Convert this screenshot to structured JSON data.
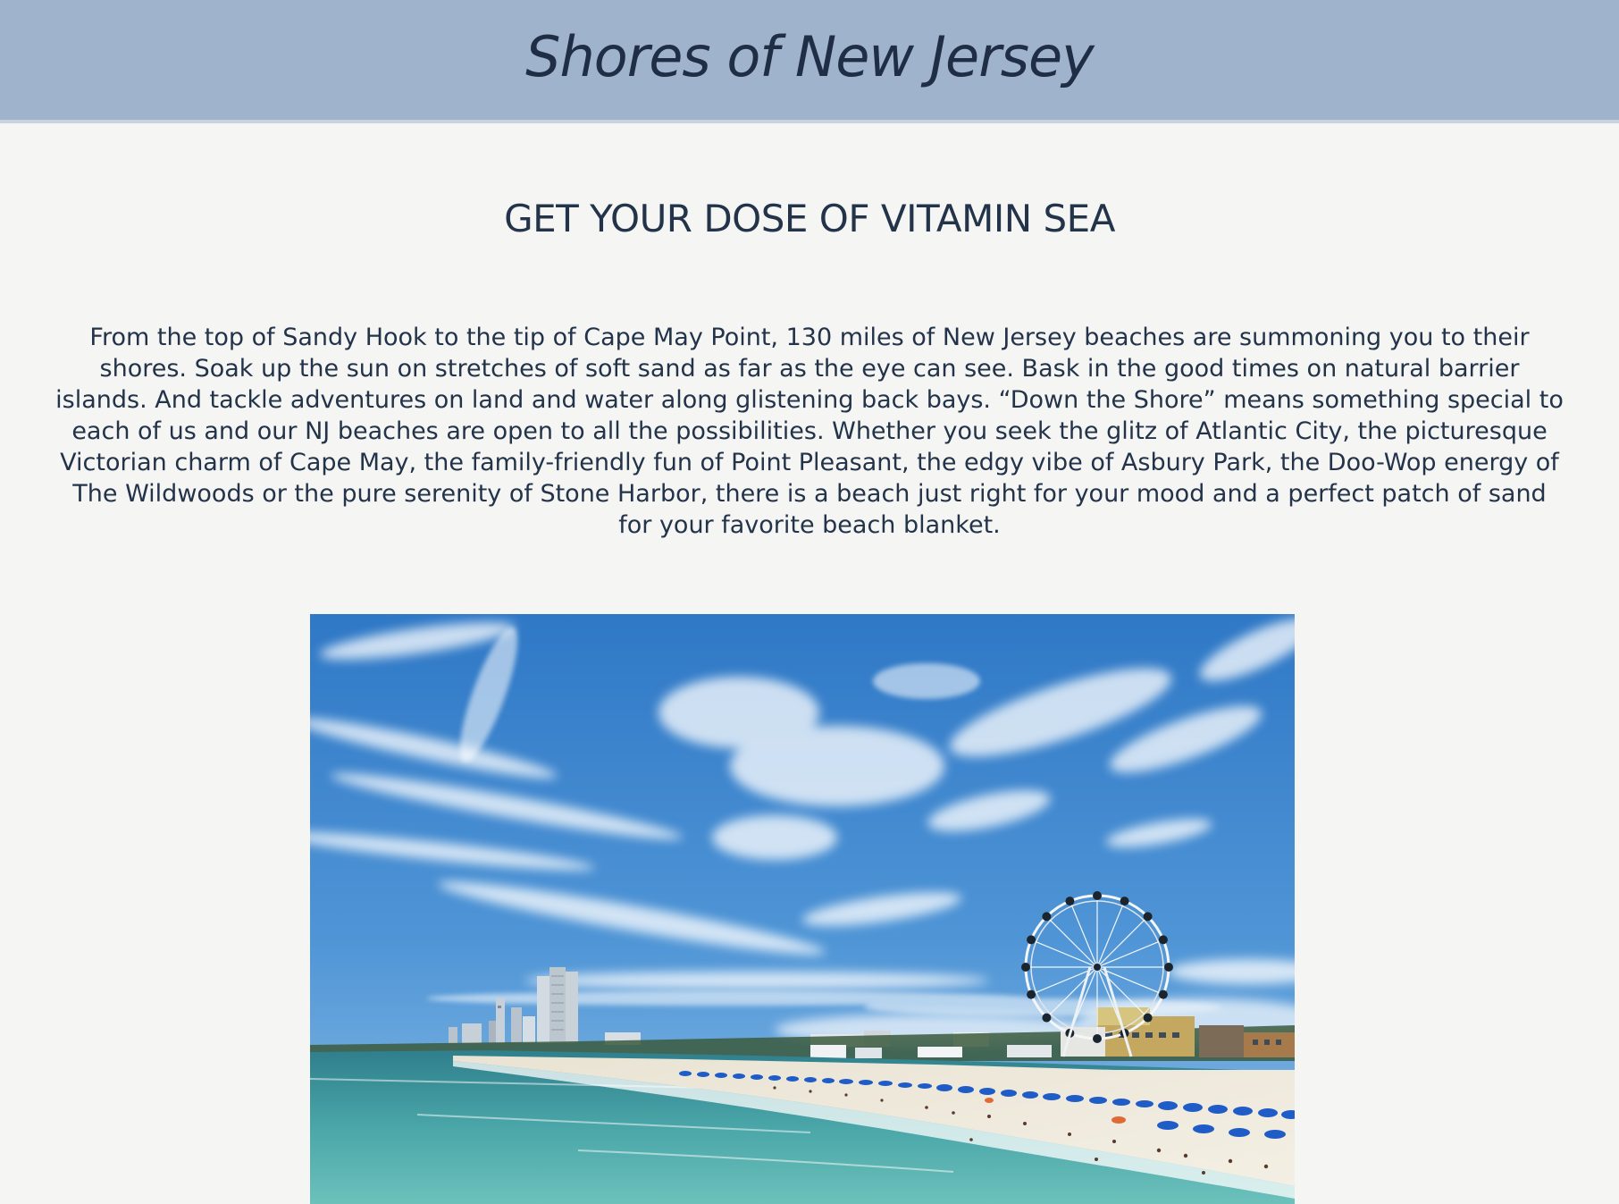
{
  "header": {
    "site_title": "Shores of New Jersey"
  },
  "main": {
    "headline": "GET YOUR DOSE OF VITAMIN SEA",
    "intro": "From the top of Sandy Hook to the tip of Cape May Point, 130 miles of New Jersey beaches are summoning you to their shores. Soak up the sun on stretches of soft sand as far as the eye can see. Bask in the good times on natural barrier islands. And tackle adventures on land and water along glistening back bays. “Down the Shore” means something special to each of us and our NJ beaches are open to all the possibilities. Whether you seek the glitz of Atlantic City, the picturesque Victorian charm of Cape May, the family-friendly fun of Point Pleasant, the edgy vibe of Asbury Park, the Doo-Wop energy of The Wildwoods or the pure serenity of Stone Harbor, there is a beach just right for your mood and a perfect patch of sand for your favorite beach blanket."
  },
  "colors": {
    "header_bg": "#a0b3cd",
    "page_bg": "#f5f5f3",
    "text": "#23334a"
  }
}
